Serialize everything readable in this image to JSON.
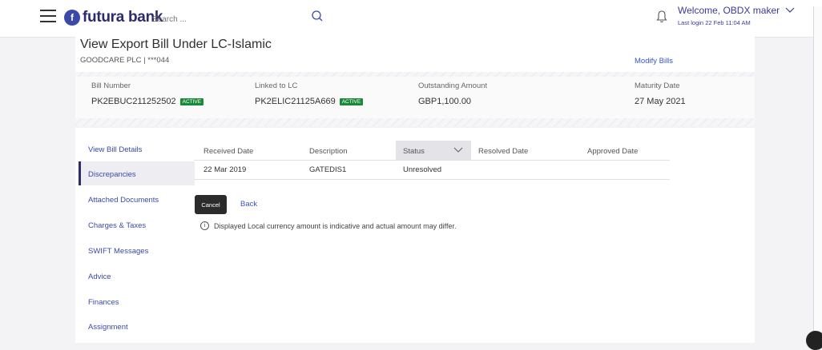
{
  "header": {
    "logo_text": "futura bank",
    "search_placeholder": "Search ...",
    "welcome": "Welcome, OBDX maker",
    "last_login": "Last login 22 Feb 11:04 AM"
  },
  "page": {
    "title": "View Export Bill Under LC-Islamic",
    "party": "GOODCARE PLC | ***044",
    "modify_link": "Modify Bills"
  },
  "summary": {
    "bill_number_label": "Bill Number",
    "bill_number": "PK2EBUC211252502",
    "bill_status": "ACTIVE",
    "linked_lc_label": "Linked to LC",
    "linked_lc": "PK2ELIC21125A669",
    "lc_status": "ACTIVE",
    "outstanding_label": "Outstanding Amount",
    "outstanding": "GBP1,100.00",
    "maturity_label": "Maturity Date",
    "maturity": "27 May 2021"
  },
  "nav": {
    "items": [
      "View Bill Details",
      "Discrepancies",
      "Attached Documents",
      "Charges & Taxes",
      "SWIFT Messages",
      "Advice",
      "Finances",
      "Assignment"
    ],
    "active": "Discrepancies"
  },
  "table": {
    "headers": [
      "Received Date",
      "Description",
      "Status",
      "Resolved Date",
      "Approved Date"
    ],
    "rows": [
      [
        "22 Mar 2019",
        "GATEDIS1",
        "Unresolved",
        "",
        ""
      ]
    ]
  },
  "actions": {
    "cancel": "Cancel",
    "back": "Back"
  },
  "note": "Displayed Local currency amount is indicative and actual amount may differ.",
  "colors": {
    "brand": "#2b2b6d",
    "link": "#3a55c8",
    "badge": "#1a8a3a"
  }
}
